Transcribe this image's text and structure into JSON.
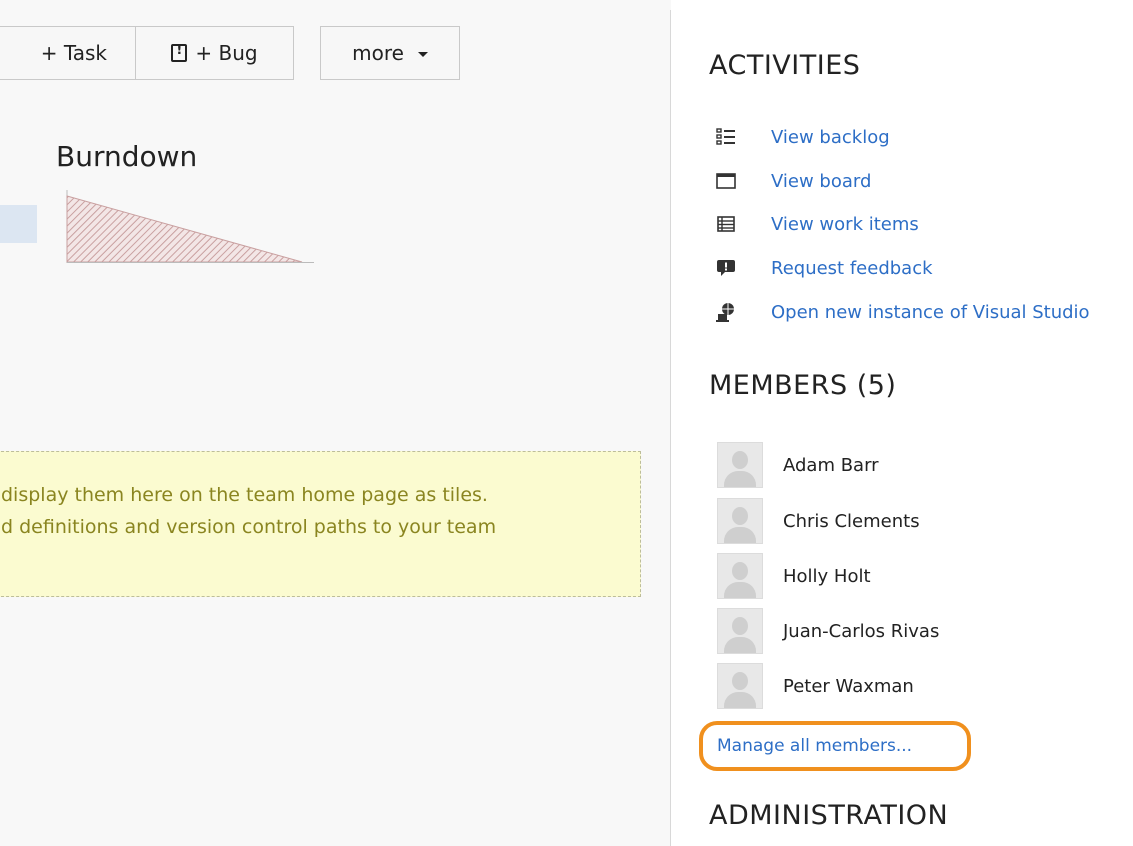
{
  "toolbar": {
    "task_label": "+ Task",
    "bug_label": "+ Bug",
    "more_label": "more"
  },
  "burndown": {
    "title": "Burndown"
  },
  "notice": {
    "line1": "display them here on the team home page as tiles.",
    "line2": "d definitions and version control paths to your team"
  },
  "activities": {
    "heading": "ACTIVITIES",
    "items": [
      {
        "label": "View backlog",
        "icon": "backlog-list-icon"
      },
      {
        "label": "View board",
        "icon": "board-icon"
      },
      {
        "label": "View work items",
        "icon": "work-items-icon"
      },
      {
        "label": "Request feedback",
        "icon": "feedback-icon"
      },
      {
        "label": "Open new instance of Visual Studio",
        "icon": "visual-studio-icon"
      }
    ]
  },
  "members": {
    "heading": "MEMBERS (5)",
    "list": [
      {
        "name": "Adam Barr"
      },
      {
        "name": "Chris Clements"
      },
      {
        "name": "Holly Holt"
      },
      {
        "name": "Juan-Carlos Rivas"
      },
      {
        "name": "Peter Waxman"
      }
    ],
    "manage_label": "Manage all members..."
  },
  "administration": {
    "heading": "ADMINISTRATION"
  },
  "colors": {
    "link": "#2d6ec6",
    "highlight_ring": "#f0901e",
    "notice_bg": "#fbfbd0",
    "notice_text": "#8a8520",
    "burndown_hatch": "#c9a0a0"
  }
}
